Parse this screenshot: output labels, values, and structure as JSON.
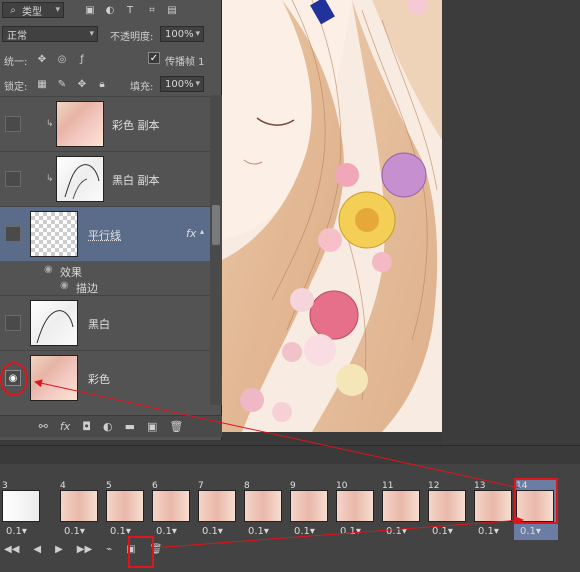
{
  "filter_bar": {
    "kind_label": "类型"
  },
  "blend": {
    "mode": "正常",
    "opacity_label": "不透明度:",
    "opacity_value": "100%"
  },
  "unify": {
    "label": "统一:",
    "propagate_label": "传播帧 1"
  },
  "lock": {
    "label": "锁定:",
    "fill_label": "填充:",
    "fill_value": "100%"
  },
  "layers": [
    {
      "name": "彩色 副本",
      "visible": false,
      "clipped": true,
      "thumb": "color"
    },
    {
      "name": "黑白 副本",
      "visible": false,
      "clipped": true,
      "thumb": "bw"
    },
    {
      "name": "平行线",
      "visible": false,
      "clipped": false,
      "thumb": "transparent",
      "selected": true,
      "fx": "fx"
    },
    {
      "name": "黑白",
      "visible": false,
      "clipped": false,
      "thumb": "bw"
    },
    {
      "name": "彩色",
      "visible": true,
      "clipped": false,
      "thumb": "color"
    }
  ],
  "effects": {
    "label": "效果",
    "stroke_label": "描边"
  },
  "timeline": {
    "frames": [
      {
        "num": "3",
        "delay": "0.1▾"
      },
      {
        "num": "4",
        "delay": "0.1▾"
      },
      {
        "num": "5",
        "delay": "0.1▾"
      },
      {
        "num": "6",
        "delay": "0.1▾"
      },
      {
        "num": "7",
        "delay": "0.1▾"
      },
      {
        "num": "8",
        "delay": "0.1▾"
      },
      {
        "num": "9",
        "delay": "0.1▾"
      },
      {
        "num": "10",
        "delay": "0.1▾"
      },
      {
        "num": "11",
        "delay": "0.1▾"
      },
      {
        "num": "12",
        "delay": "0.1▾"
      },
      {
        "num": "13",
        "delay": "0.1▾"
      },
      {
        "num": "14",
        "delay": "0.1▾",
        "selected": true
      }
    ]
  },
  "colors": {
    "annotation": "#e0141b",
    "selected_layer": "#5b6c8a",
    "panel": "#535353"
  }
}
